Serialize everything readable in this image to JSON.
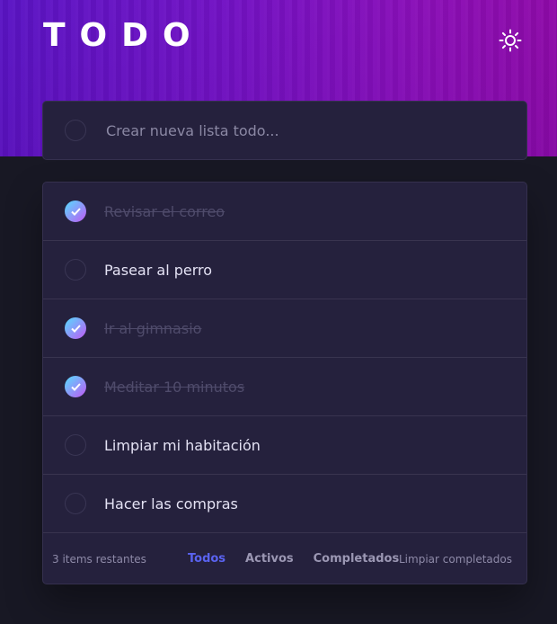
{
  "header": {
    "title": "TODO",
    "theme_icon": "sun-icon"
  },
  "new_todo": {
    "placeholder": "Crear nueva lista todo..."
  },
  "todos": [
    {
      "text": "Revisar el correo",
      "completed": true
    },
    {
      "text": "Pasear al perro",
      "completed": false
    },
    {
      "text": "Ir al gimnasio",
      "completed": true
    },
    {
      "text": "Meditar 10 minutos",
      "completed": true
    },
    {
      "text": "Limpiar mi habitación",
      "completed": false
    },
    {
      "text": "Hacer las compras",
      "completed": false
    }
  ],
  "footer": {
    "items_left": "3 items restantes",
    "filters": [
      "Todos",
      "Activos",
      "Completados"
    ],
    "active_filter": "Todos",
    "clear_label": "Limpiar completados"
  },
  "colors": {
    "accent": "#5a63f0",
    "check_gradient_start": "#55ddff",
    "check_gradient_end": "#c058f3"
  }
}
